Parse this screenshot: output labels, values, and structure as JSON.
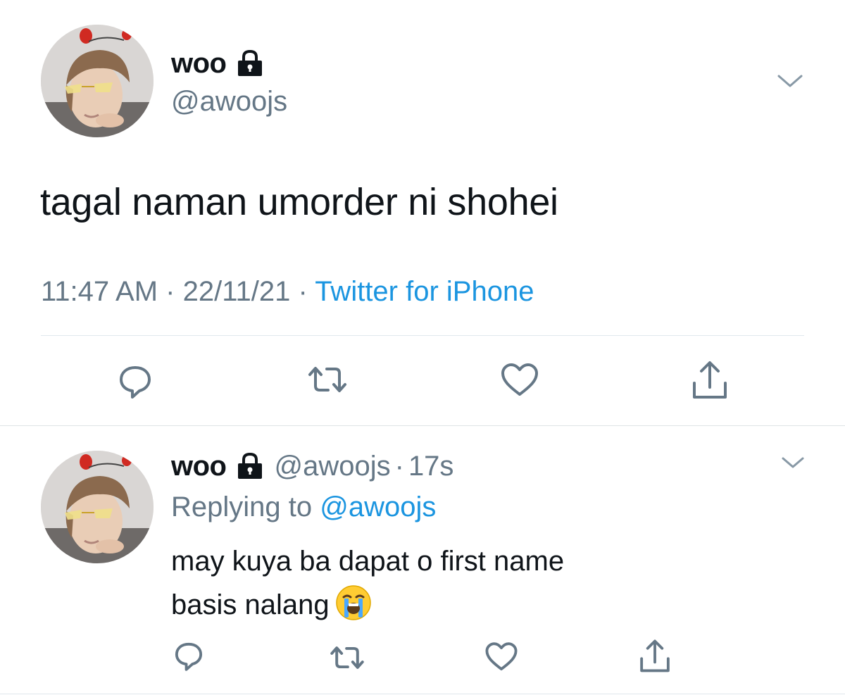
{
  "colors": {
    "text": "#0f1419",
    "muted": "#657786",
    "link": "#1b95e0",
    "divider": "#e1e8ed",
    "icon": "#657786"
  },
  "main_tweet": {
    "display_name": "woo",
    "handle": "@awoojs",
    "locked_icon": "lock-icon",
    "text": "tagal naman umorder ni shohei",
    "time": "11:47 AM",
    "date": "22/11/21",
    "separator": "·",
    "source": "Twitter for iPhone",
    "actions": [
      "reply-icon",
      "retweet-icon",
      "like-icon",
      "share-icon"
    ]
  },
  "reply_tweet": {
    "display_name": "woo",
    "handle": "@awoojs",
    "separator": "·",
    "age": "17s",
    "replying_prefix": "Replying to",
    "replying_handle": "@awoojs",
    "text_line1": "may kuya ba dapat o first name",
    "text_line2": "basis nalang",
    "emoji": "loudly-crying-face-emoji",
    "actions": [
      "reply-icon",
      "retweet-icon",
      "like-icon",
      "share-icon"
    ]
  }
}
